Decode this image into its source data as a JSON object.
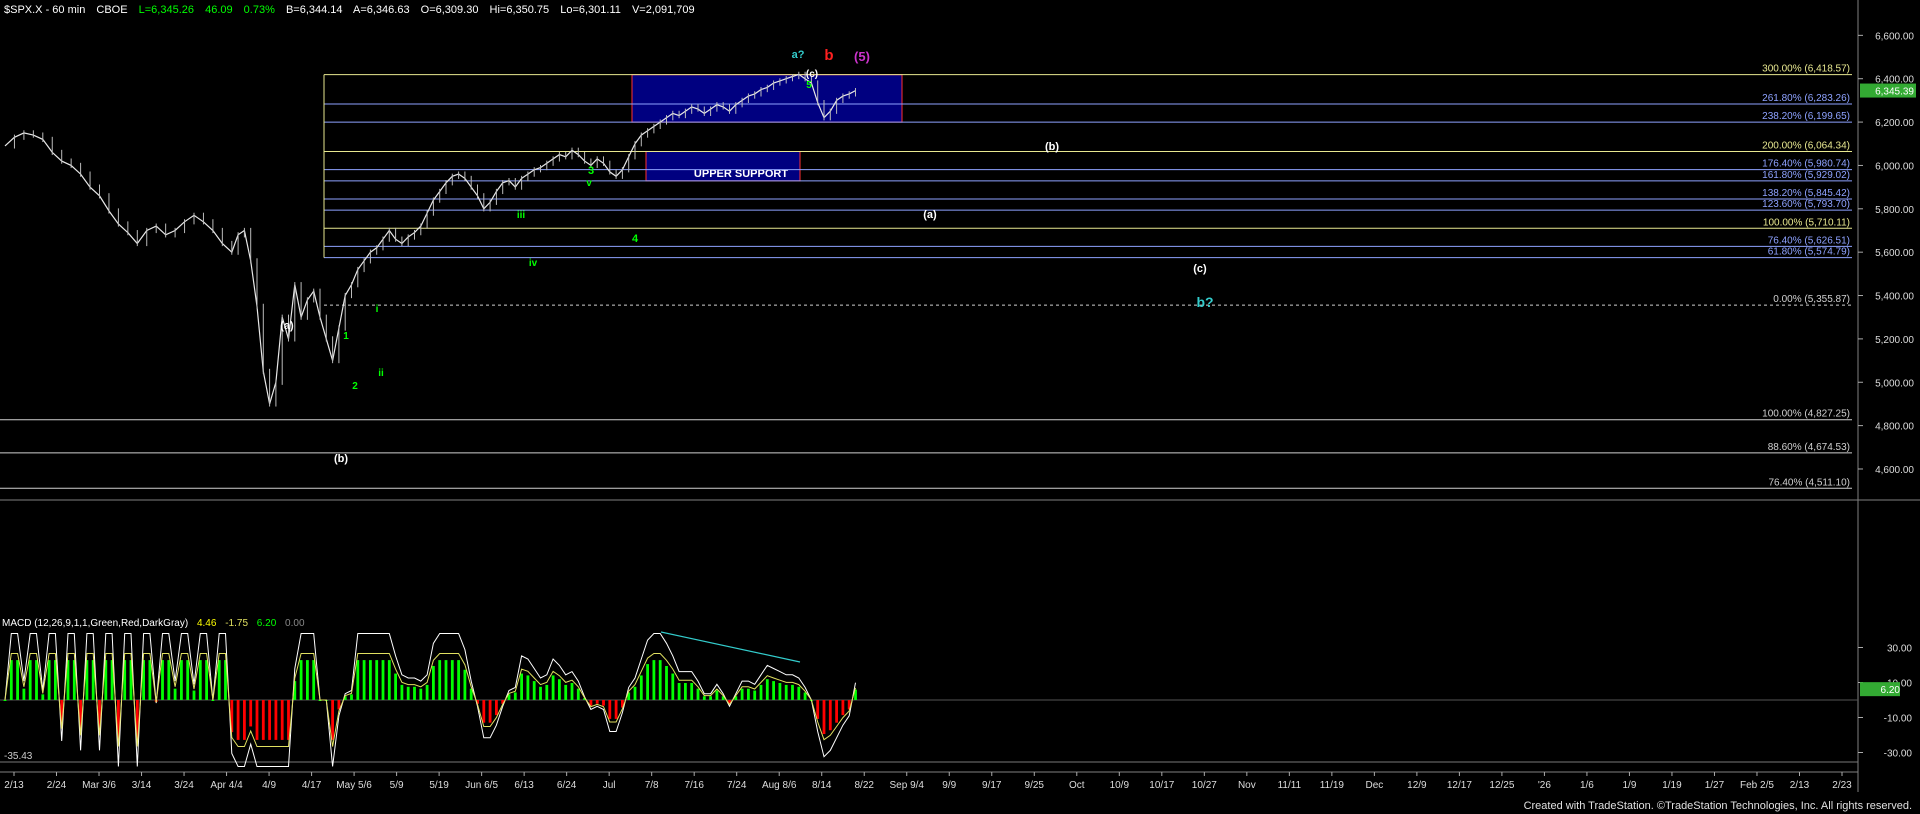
{
  "header": {
    "symbol": "$SPX.X - 60 min",
    "exchange": "CBOE",
    "last": "L=6,345.26",
    "change": "46.09",
    "pct": "0.73%",
    "bid": "B=6,344.14",
    "ask": "A=6,346.63",
    "open": "O=6,309.30",
    "high": "Hi=6,350.75",
    "low": "Lo=6,301.11",
    "volume": "V=2,091,709"
  },
  "footer": "Created with TradeStation. ©TradeStation Technologies, Inc. All rights reserved.",
  "macd_header": {
    "label": "MACD (12,26,9,1,1,Green,Red,DarkGray)",
    "v1": "4.46",
    "v2": "-1.75",
    "v3": "6.20",
    "v4": "0.00"
  },
  "colors": {
    "background": "#000000",
    "bull_hist": "#00ff00",
    "bear_hist": "#ff0000",
    "box_fill": "#000080",
    "fib_line_yellow": "#e8e890",
    "fib_line_blue": "#8ea2ff",
    "macd_line": "#ffffff",
    "signal_line": "#e0e060",
    "wave_green": "#00ff00",
    "wave_white": "#ffffff",
    "wave_cyan": "#33cccc",
    "wave_red": "#ff2020",
    "wave_magenta": "#cc33cc"
  },
  "chart_data": {
    "type": "line",
    "title": "$SPX.X - 60 min",
    "y_ticks": [
      "6,600.00",
      "6,400.00",
      "6,200.00",
      "6,000.00",
      "5,800.00",
      "5,600.00",
      "5,400.00",
      "5,200.00",
      "5,000.00",
      "4,800.00",
      "4,600.00"
    ],
    "y_tick_values": [
      6600,
      6400,
      6200,
      6000,
      5800,
      5600,
      5400,
      5200,
      5000,
      4800,
      4600
    ],
    "ylim": [
      4480,
      6680
    ],
    "last_price_label": "6,345.39",
    "x_ticks": [
      "2/13",
      "2/24",
      "Mar 3/6",
      "3/14",
      "3/24",
      "Apr 4/4",
      "4/9",
      "4/17",
      "May 5/6",
      "5/9",
      "5/19",
      "Jun 6/5",
      "6/13",
      "6/24",
      "Jul",
      "7/8",
      "7/16",
      "7/24",
      "Aug 8/6",
      "8/14",
      "8/22",
      "Sep 9/4",
      "9/9",
      "9/17",
      "9/25",
      "Oct",
      "10/9",
      "10/17",
      "10/27",
      "Nov",
      "11/11",
      "11/19",
      "Dec",
      "12/9",
      "12/17",
      "12/25",
      "'26",
      "1/6",
      "1/9",
      "1/19",
      "1/27",
      "Feb 2/5",
      "2/13",
      "2/23"
    ],
    "price_path": [
      [
        0,
        6090
      ],
      [
        3,
        6130
      ],
      [
        6,
        6150
      ],
      [
        9,
        6140
      ],
      [
        12,
        6120
      ],
      [
        15,
        6060
      ],
      [
        18,
        6020
      ],
      [
        21,
        6000
      ],
      [
        24,
        5960
      ],
      [
        27,
        5900
      ],
      [
        30,
        5860
      ],
      [
        33,
        5790
      ],
      [
        36,
        5730
      ],
      [
        39,
        5690
      ],
      [
        42,
        5640
      ],
      [
        45,
        5700
      ],
      [
        48,
        5720
      ],
      [
        51,
        5680
      ],
      [
        54,
        5700
      ],
      [
        57,
        5740
      ],
      [
        60,
        5770
      ],
      [
        63,
        5740
      ],
      [
        66,
        5700
      ],
      [
        69,
        5640
      ],
      [
        72,
        5600
      ],
      [
        74,
        5680
      ],
      [
        76,
        5700
      ],
      [
        78,
        5560
      ],
      [
        80,
        5350
      ],
      [
        82,
        5050
      ],
      [
        84,
        4900
      ],
      [
        86,
        5000
      ],
      [
        88,
        5300
      ],
      [
        90,
        5200
      ],
      [
        92,
        5450
      ],
      [
        94,
        5300
      ],
      [
        96,
        5380
      ],
      [
        98,
        5420
      ],
      [
        100,
        5300
      ],
      [
        102,
        5200
      ],
      [
        104,
        5100
      ],
      [
        106,
        5250
      ],
      [
        108,
        5400
      ],
      [
        110,
        5450
      ],
      [
        112,
        5520
      ],
      [
        114,
        5560
      ],
      [
        116,
        5600
      ],
      [
        118,
        5620
      ],
      [
        120,
        5660
      ],
      [
        122,
        5700
      ],
      [
        124,
        5660
      ],
      [
        126,
        5640
      ],
      [
        128,
        5670
      ],
      [
        130,
        5690
      ],
      [
        132,
        5720
      ],
      [
        134,
        5780
      ],
      [
        136,
        5840
      ],
      [
        138,
        5880
      ],
      [
        140,
        5920
      ],
      [
        142,
        5950
      ],
      [
        144,
        5960
      ],
      [
        146,
        5940
      ],
      [
        148,
        5900
      ],
      [
        150,
        5860
      ],
      [
        152,
        5800
      ],
      [
        154,
        5830
      ],
      [
        156,
        5880
      ],
      [
        158,
        5920
      ],
      [
        160,
        5930
      ],
      [
        162,
        5900
      ],
      [
        164,
        5940
      ],
      [
        166,
        5960
      ],
      [
        168,
        5980
      ],
      [
        170,
        5990
      ],
      [
        172,
        6010
      ],
      [
        174,
        6030
      ],
      [
        176,
        6050
      ],
      [
        178,
        6040
      ],
      [
        180,
        6070
      ],
      [
        182,
        6050
      ],
      [
        184,
        6020
      ],
      [
        186,
        6000
      ],
      [
        188,
        6030
      ],
      [
        190,
        6010
      ],
      [
        192,
        5970
      ],
      [
        194,
        5950
      ],
      [
        196,
        5980
      ],
      [
        198,
        6040
      ],
      [
        200,
        6100
      ],
      [
        202,
        6140
      ],
      [
        204,
        6160
      ],
      [
        206,
        6180
      ],
      [
        208,
        6200
      ],
      [
        210,
        6220
      ],
      [
        212,
        6240
      ],
      [
        214,
        6230
      ],
      [
        216,
        6250
      ],
      [
        218,
        6270
      ],
      [
        220,
        6260
      ],
      [
        222,
        6240
      ],
      [
        224,
        6260
      ],
      [
        226,
        6280
      ],
      [
        228,
        6270
      ],
      [
        230,
        6250
      ],
      [
        232,
        6280
      ],
      [
        234,
        6300
      ],
      [
        236,
        6320
      ],
      [
        238,
        6330
      ],
      [
        240,
        6350
      ],
      [
        242,
        6360
      ],
      [
        244,
        6380
      ],
      [
        246,
        6390
      ],
      [
        248,
        6400
      ],
      [
        250,
        6410
      ],
      [
        252,
        6420
      ],
      [
        254,
        6400
      ],
      [
        256,
        6380
      ],
      [
        258,
        6290
      ],
      [
        260,
        6220
      ],
      [
        262,
        6250
      ],
      [
        264,
        6300
      ],
      [
        266,
        6320
      ],
      [
        268,
        6330
      ],
      [
        270,
        6345
      ]
    ],
    "fib_levels": [
      {
        "label": "300.00% (6,418.57)",
        "value": 6418.57,
        "color": "yellow"
      },
      {
        "label": "261.80% (6,283.26)",
        "value": 6283.26,
        "color": "blue"
      },
      {
        "label": "238.20% (6,199.65)",
        "value": 6199.65,
        "color": "blue"
      },
      {
        "label": "200.00% (6,064.34)",
        "value": 6064.34,
        "color": "yellow"
      },
      {
        "label": "176.40% (5,980.74)",
        "value": 5980.74,
        "color": "blue"
      },
      {
        "label": "161.80% (5,929.02)",
        "value": 5929.02,
        "color": "blue"
      },
      {
        "label": "138.20% (5,845.42)",
        "value": 5845.42,
        "color": "blue"
      },
      {
        "label": "123.60% (5,793.70)",
        "value": 5793.7,
        "color": "blue"
      },
      {
        "label": "100.00% (5,710.11)",
        "value": 5710.11,
        "color": "yellow"
      },
      {
        "label": "76.40% (5,626.51)",
        "value": 5626.51,
        "color": "blue"
      },
      {
        "label": "61.80% (5,574.79)",
        "value": 5574.79,
        "color": "blue"
      },
      {
        "label": "0.00% (5,355.87)",
        "value": 5355.87,
        "color": "white"
      },
      {
        "label": "100.00% (4,827.25)",
        "value": 4827.25,
        "color": "white"
      },
      {
        "label": "88.60% (4,674.53)",
        "value": 4674.53,
        "color": "white"
      },
      {
        "label": "76.40% (4,511.10)",
        "value": 4511.1,
        "color": "white"
      }
    ],
    "zones": [
      {
        "label": "",
        "from": 6199.65,
        "to": 6418.57
      },
      {
        "label": "UPPER SUPPORT",
        "from": 5929.02,
        "to": 6064.34
      }
    ],
    "wave_labels": [
      {
        "text": "(a)",
        "color": "white"
      },
      {
        "text": "(b)",
        "color": "white"
      },
      {
        "text": "1",
        "color": "green"
      },
      {
        "text": "2",
        "color": "green"
      },
      {
        "text": "i",
        "color": "green"
      },
      {
        "text": "ii",
        "color": "green"
      },
      {
        "text": "iii",
        "color": "green"
      },
      {
        "text": "iv",
        "color": "green"
      },
      {
        "text": "v",
        "color": "green"
      },
      {
        "text": "3",
        "color": "green"
      },
      {
        "text": "4",
        "color": "green"
      },
      {
        "text": "5",
        "color": "green"
      },
      {
        "text": "(c)",
        "color": "white"
      },
      {
        "text": "a?",
        "color": "cyan"
      },
      {
        "text": "b",
        "color": "red"
      },
      {
        "text": "(5)",
        "color": "magenta"
      },
      {
        "text": "(b)",
        "color": "white"
      },
      {
        "text": "(a)",
        "color": "white"
      },
      {
        "text": "(c)",
        "color": "white"
      },
      {
        "text": "b?",
        "color": "cyan"
      }
    ],
    "macd": {
      "y_ticks": [
        "30.00",
        "10.00",
        "-10.00",
        "-30.00"
      ],
      "y_tick_values": [
        30,
        10,
        -10,
        -30
      ],
      "ylim": [
        -40,
        40
      ],
      "min_label": "-35.43",
      "last_label": "6.20"
    }
  }
}
